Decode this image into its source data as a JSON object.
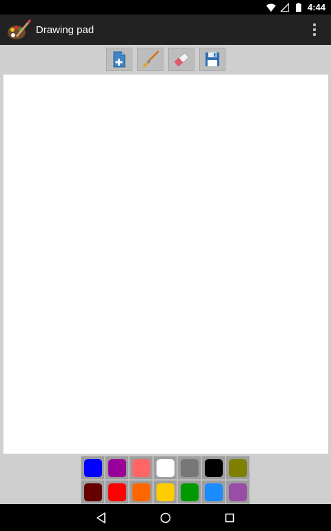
{
  "status_bar": {
    "time": "4:44",
    "icons": [
      "wifi-icon",
      "signal-icon",
      "battery-icon"
    ]
  },
  "action_bar": {
    "title": "Drawing pad",
    "app_icon": "palette-brush-icon",
    "overflow_icon": "overflow-menu-icon"
  },
  "toolbar": {
    "items": [
      {
        "name": "new-page",
        "icon": "new-document-icon"
      },
      {
        "name": "brush",
        "icon": "brush-icon"
      },
      {
        "name": "eraser",
        "icon": "eraser-icon"
      },
      {
        "name": "save",
        "icon": "floppy-disk-icon"
      }
    ]
  },
  "palette": {
    "colors": [
      "#0000ff",
      "#990099",
      "#ff6666",
      "#ffffff",
      "#777777",
      "#000000",
      "#808000",
      "#660000",
      "#ff0000",
      "#ff6600",
      "#ffcc00",
      "#009900",
      "#1a8cff",
      "#994da6"
    ]
  },
  "nav_bar": {
    "buttons": [
      "back-icon",
      "home-icon",
      "recents-icon"
    ]
  }
}
